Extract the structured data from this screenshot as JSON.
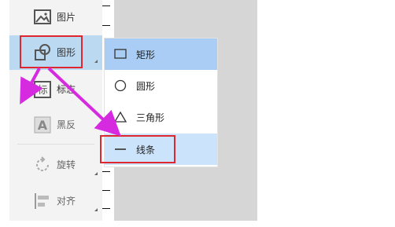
{
  "toolbar": {
    "items": [
      {
        "label": "图片",
        "icon": "picture-icon"
      },
      {
        "label": "图形",
        "icon": "shape-icon"
      },
      {
        "label": "标志",
        "icon": "marker-icon"
      },
      {
        "label": "黑反",
        "icon": "invert-icon"
      },
      {
        "label": "旋转",
        "icon": "rotate-icon"
      },
      {
        "label": "对齐",
        "icon": "align-icon"
      }
    ]
  },
  "submenu": {
    "items": [
      {
        "label": "矩形",
        "icon": "rectangle-icon"
      },
      {
        "label": "圆形",
        "icon": "circle-icon"
      },
      {
        "label": "三角形",
        "icon": "triangle-icon"
      },
      {
        "label": "线条",
        "icon": "line-icon"
      }
    ]
  },
  "colors": {
    "highlight_box": "#e0262f",
    "arrow": "#d62ae0",
    "submenu_hover": "#a9cdf5",
    "submenu_selected": "#cce4fb"
  }
}
